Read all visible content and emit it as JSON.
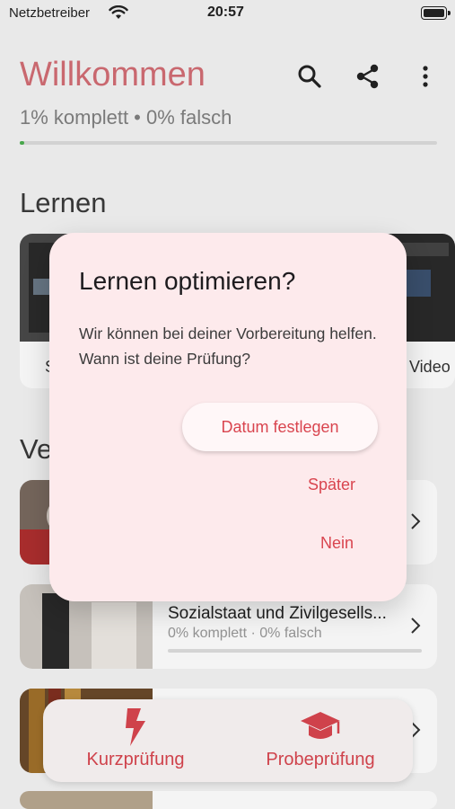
{
  "statusbar": {
    "carrier": "Netzbetreiber",
    "time": "20:57"
  },
  "header": {
    "title": "Willkommen",
    "progress_text": "1% komplett • 0% falsch",
    "progress": 0.01,
    "icons": [
      "search-icon",
      "share-icon",
      "more-vert-icon"
    ]
  },
  "sections": {
    "lernen": "Lernen",
    "ve": "Ve"
  },
  "lernen_cards": [
    {
      "label": "S"
    },
    {
      "label": "Video"
    }
  ],
  "rows": [
    {
      "title": "",
      "subtitle": ""
    },
    {
      "title": "Sozialstaat und Zivilgesells...",
      "subtitle": "0% komplett · 0% falsch"
    },
    {
      "title": "",
      "subtitle": ""
    }
  ],
  "bottom_nav": [
    {
      "label": "Kurzprüfung",
      "icon": "flash-icon"
    },
    {
      "label": "Probeprüfung",
      "icon": "graduation-cap-icon"
    }
  ],
  "dialog": {
    "title": "Lernen optimieren?",
    "body": "Wir können bei deiner Vorbereitung helfen. Wann ist deine Prüfung?",
    "primary_button": "Datum festlegen",
    "later_button": "Später",
    "no_button": "Nein"
  },
  "colors": {
    "accent": "#d9454f",
    "title": "#d36d75",
    "dialog_bg": "#fdeaec",
    "progress": "#4caf50"
  }
}
